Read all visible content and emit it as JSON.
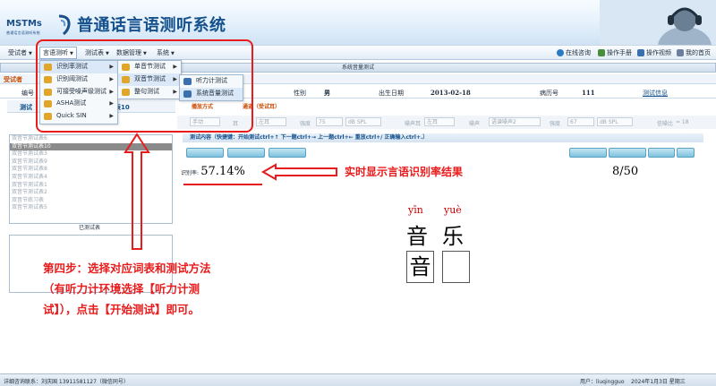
{
  "header": {
    "logo_text": "MSTMs",
    "logo_sub": "普通话言语测听系统",
    "app_title": "普通话言语测听系统"
  },
  "menubar": {
    "items": [
      {
        "label": "受试者"
      },
      {
        "label": "言语测听"
      },
      {
        "label": "测试表"
      },
      {
        "label": "数据管理"
      },
      {
        "label": "系统"
      }
    ],
    "right": [
      {
        "label": "在线咨询",
        "icon": "info-icon"
      },
      {
        "label": "操作手册",
        "icon": "book-icon"
      },
      {
        "label": "操作视频",
        "icon": "video-icon"
      },
      {
        "label": "我的首页",
        "icon": "home-icon"
      }
    ]
  },
  "dropdown_1": {
    "items": [
      {
        "label": "识别率测试",
        "icon": "speech-icon",
        "has_sub": true
      },
      {
        "label": "识别阈测试",
        "icon": "speech-icon",
        "has_sub": true
      },
      {
        "label": "可接受噪声级测试",
        "icon": "speech-icon",
        "has_sub": true
      },
      {
        "label": "ASHA测试",
        "icon": "speech-icon",
        "has_sub": true
      },
      {
        "label": "Quick SIN",
        "icon": "speech-icon",
        "has_sub": true
      }
    ]
  },
  "dropdown_2": {
    "items": [
      {
        "label": "单音节测试",
        "icon": "speech-icon",
        "has_sub": true
      },
      {
        "label": "双音节测试",
        "icon": "speech-icon",
        "has_sub": true
      },
      {
        "label": "整句测试",
        "icon": "speech-icon",
        "has_sub": true
      }
    ]
  },
  "dropdown_3": {
    "items": [
      {
        "label": "听力计测试",
        "icon": "document-icon"
      },
      {
        "label": "系统音量测试",
        "icon": "document-icon"
      }
    ]
  },
  "topbar": {
    "title": "系统音量测试"
  },
  "info": {
    "header_label": "受试者",
    "id_label": "编号",
    "sex_label": "性别",
    "sex_value": "男",
    "dob_label": "出生日期",
    "dob_value": "2013-02-18",
    "case_label": "病历号",
    "case_value": "111",
    "test_info_link": "测试信息"
  },
  "left": {
    "tab_label": "测试",
    "tab_label_suffix": "表10",
    "list": [
      "双音节测试表6",
      "双音节测试表10",
      "双音节测试表3",
      "双音节测试表9",
      "双音节测试表8",
      "双音节测试表4",
      "双音节测试表1",
      "双音节测试表2",
      "双音节练习表",
      "双音节测试表5"
    ],
    "selected_index": 1,
    "done_label": "已测试表"
  },
  "right": {
    "mode_label": "播放方式",
    "channel_label": "通道（受试耳）",
    "ctrl": {
      "manual": "手动",
      "ear_label": "耳",
      "left_ear": "左耳",
      "db_label": "强度",
      "level": "75",
      "unit": "dB SPL",
      "noise_ear_label": "噪声耳",
      "noise_ear": "左耳",
      "noise_label": "噪声",
      "noise_type": "语谱噪声2",
      "noise_level_label": "强度",
      "noise_level": "67",
      "noise_unit": "dB SPL",
      "snr_label": "信噪比",
      "snr_value": "= 18"
    },
    "hint": "测试内容（快捷键：开始测试ctrl+↑  下一题ctrl+→  上一题ctrl+←  重放ctrl+/  正确输入ctrl+.）",
    "rate_label": "识别率:",
    "rate_value": "57.14%",
    "progress": "8/50",
    "pinyin_1": "yīn",
    "pinyin_2": "yuè",
    "hanzi_1": "音",
    "hanzi_2": "乐",
    "input_1": "音",
    "input_2": ""
  },
  "annotations": {
    "rate_note": "实时显示言语识别率结果",
    "step4": "第四步：选择对应词表和测试方法（有听力计环境选择【听力计测试】），点击【开始测试】即可。",
    "color": "#e81c1c"
  },
  "footer": {
    "contact": "详细咨询联系：刘庆国   13911581127（微信同号）",
    "user": "用户：liuqingguo",
    "date": "2024年1月3日 星期三"
  }
}
